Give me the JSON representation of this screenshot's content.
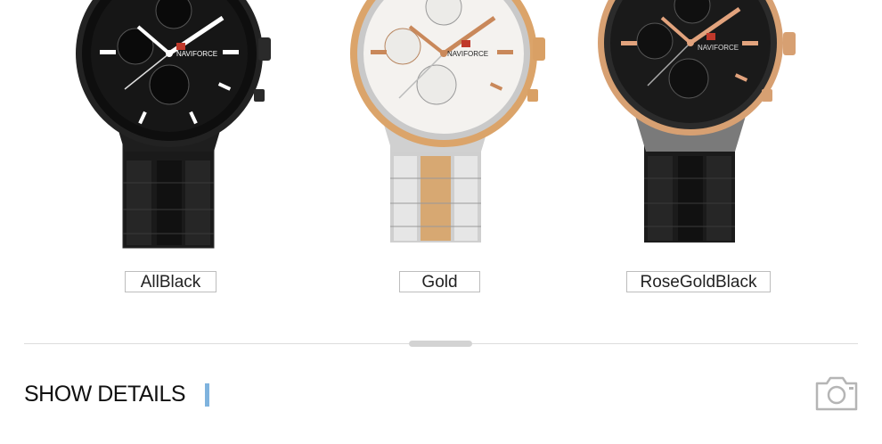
{
  "products": [
    {
      "label": "AllBlack",
      "brand": "NAVIFORCE",
      "colors": {
        "case": "#1f1f1f",
        "dial": "#141414",
        "accent": "#ffffff",
        "bracelet": "#1c1c1c"
      }
    },
    {
      "label": "Gold",
      "brand": "NAVIFORCE",
      "colors": {
        "case": "#d9a569",
        "dial": "#f3f1ee",
        "accent": "#c9885a",
        "bracelet": "#c4c4c4"
      }
    },
    {
      "label": "RoseGoldBlack",
      "brand": "NAVIFORCE",
      "colors": {
        "case": "#d7a072",
        "dial": "#1c1c1c",
        "accent": "#e2a37d",
        "bracelet": "#1f1f1f"
      }
    }
  ],
  "details": {
    "title": "SHOW DETAILS",
    "accent_color": "#7fb3de",
    "icon": "camera-icon"
  }
}
